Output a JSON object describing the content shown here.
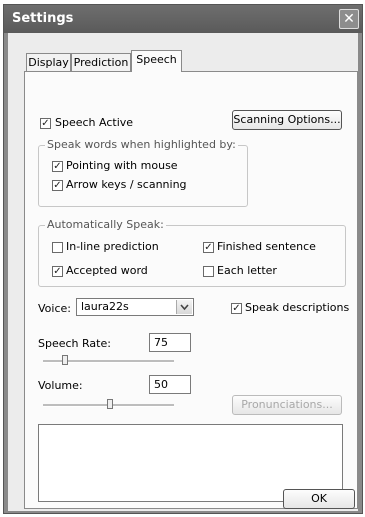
{
  "window": {
    "title": "Settings",
    "close_glyph": "✕"
  },
  "tabs": [
    {
      "label": "Display",
      "active": false
    },
    {
      "label": "Prediction",
      "active": false
    },
    {
      "label": "Speech",
      "active": true
    }
  ],
  "speech": {
    "speech_active": {
      "label": "Speech Active",
      "checked": true
    },
    "scanning_options_label": "Scanning Options...",
    "highlight_group": {
      "title": "Speak words when highlighted by:",
      "items": [
        {
          "label": "Pointing with mouse",
          "checked": true
        },
        {
          "label": "Arrow keys / scanning",
          "checked": true
        }
      ]
    },
    "auto_group": {
      "title": "Automatically Speak:",
      "items": [
        {
          "label": "In-line prediction",
          "checked": false
        },
        {
          "label": "Finished sentence",
          "checked": true
        },
        {
          "label": "Accepted word",
          "checked": true
        },
        {
          "label": "Each letter",
          "checked": false
        }
      ]
    },
    "voice": {
      "label": "Voice:",
      "value": "laura22s"
    },
    "speak_descriptions": {
      "label": "Speak descriptions",
      "checked": true
    },
    "speech_rate": {
      "label": "Speech Rate:",
      "value": "75"
    },
    "volume": {
      "label": "Volume:",
      "value": "50"
    },
    "pronunciations_label": "Pronunciations...",
    "text_area_value": ""
  },
  "footer": {
    "ok_label": "OK"
  },
  "icons": {
    "checkmark": "✓",
    "dropdown": "chevron-down-icon"
  },
  "colors": {
    "titlebar": "#5f5f5f",
    "dialog_bg": "#ececec",
    "page_bg": "#fbfbfb"
  }
}
